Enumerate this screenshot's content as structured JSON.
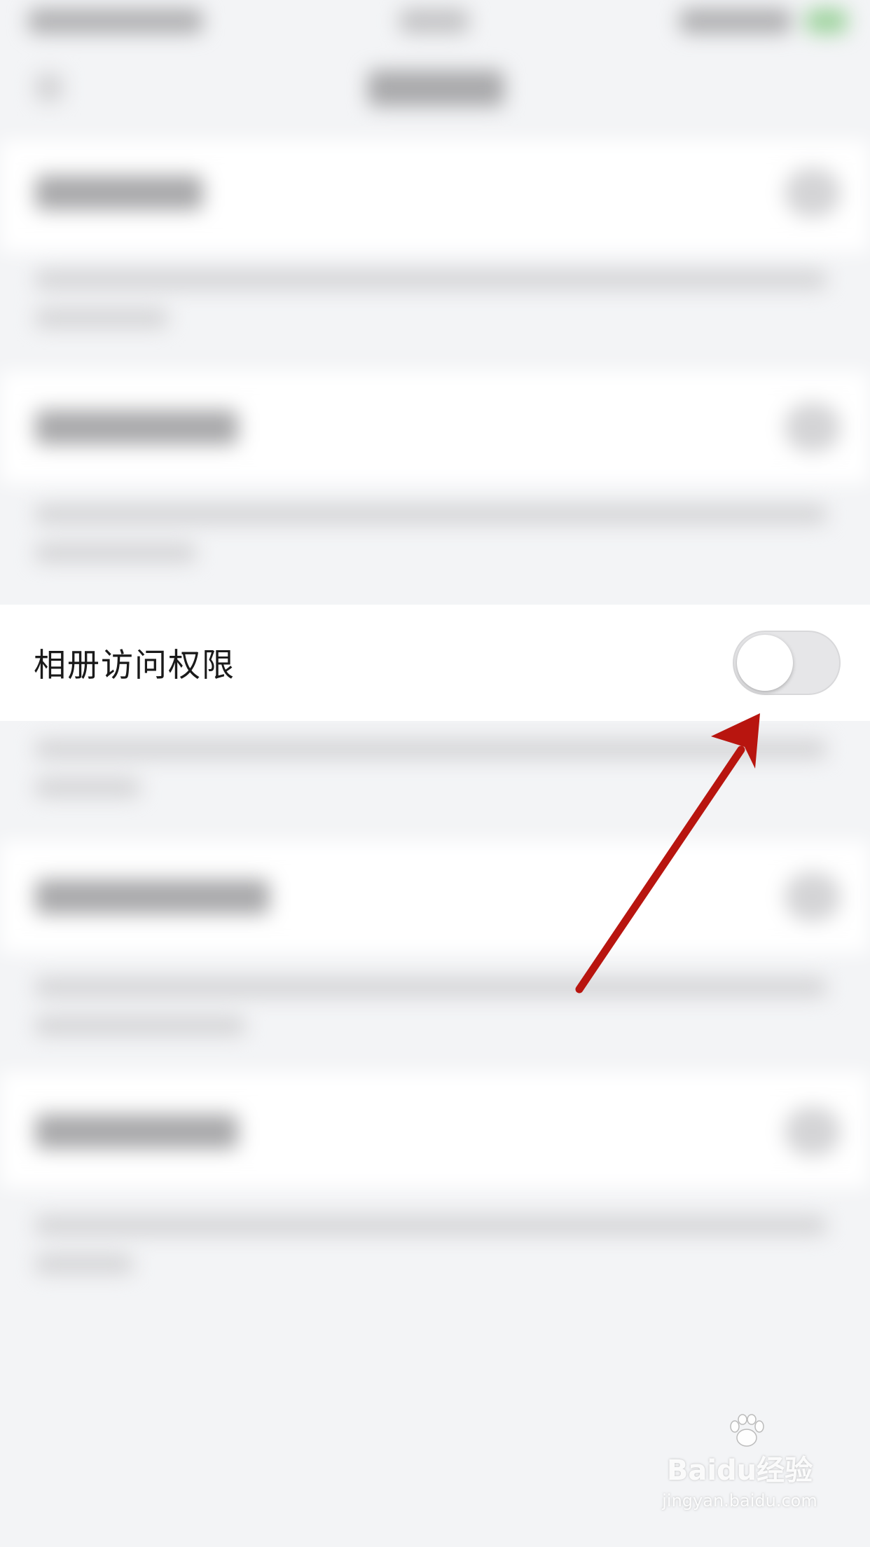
{
  "setting": {
    "label": "相册访问权限",
    "toggle_on": false
  },
  "annotation": {
    "arrow_color": "#b8150f",
    "arrow_target": "album-access-toggle"
  },
  "watermark": {
    "brand": "Baidu经验",
    "url": "jingyan.baidu.com"
  },
  "colors": {
    "page_background": "#f3f4f6",
    "card_background": "#ffffff",
    "toggle_off": "#e6e6e8"
  }
}
